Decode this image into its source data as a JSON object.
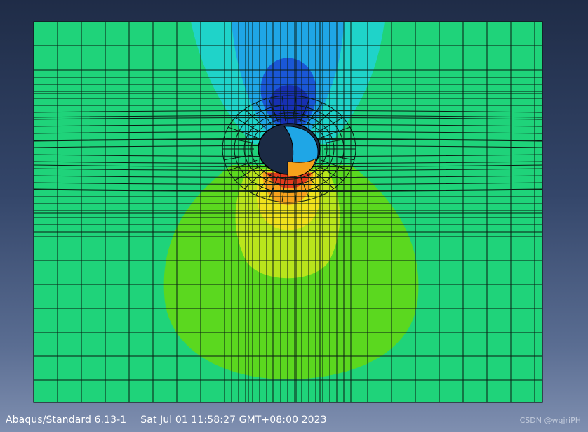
{
  "viewport": {
    "background_top": "#1f2c47",
    "background_bottom": "#7f8fb0"
  },
  "model": {
    "color_map": {
      "red": "#e23a1c",
      "orange": "#f6a21c",
      "yellow": "#f0e21c",
      "yellow_green": "#b9e51c",
      "green": "#5bd81f",
      "base_green": "#1fd37a",
      "cyan": "#1fd3c9",
      "light_blue": "#1fa6e6",
      "blue": "#1a57d6",
      "dark_blue": "#1730b3",
      "mesh_line": "#0a1a12",
      "hole": "#1b2a44"
    }
  },
  "status_bar": {
    "solver": "Abaqus/Standard 6.13-1",
    "timestamp": "Sat Jul 01 11:58:27 GMT+08:00 2023"
  },
  "watermark": {
    "text": "CSDN @wqjriPH"
  }
}
